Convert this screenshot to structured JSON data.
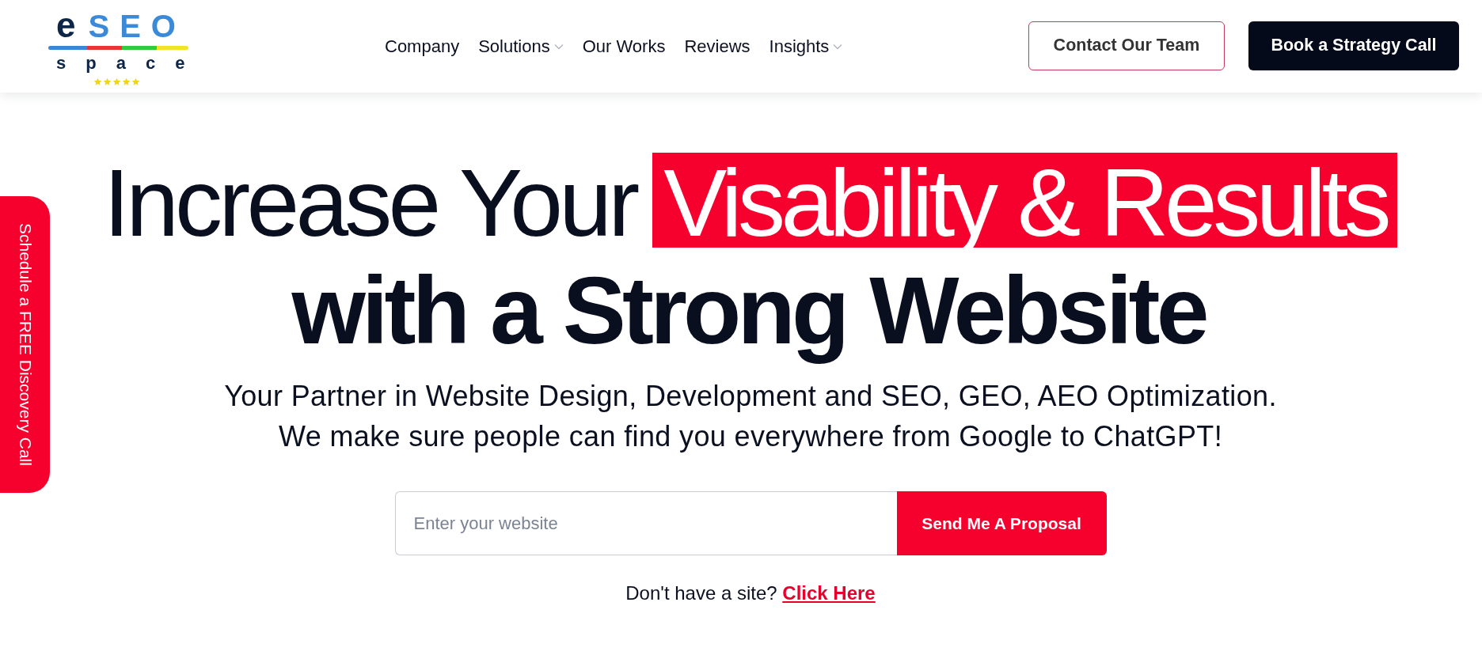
{
  "header": {
    "logo": {
      "wordmark": [
        {
          "text": "e",
          "color": "#0d2547"
        },
        {
          "text": "SEO",
          "color": "#3b8ad9"
        }
      ],
      "tagline": "space",
      "stars": 5
    },
    "nav": [
      {
        "label": "Company",
        "has_menu": false
      },
      {
        "label": "Solutions",
        "has_menu": true
      },
      {
        "label": "Our Works",
        "has_menu": false
      },
      {
        "label": "Reviews",
        "has_menu": false
      },
      {
        "label": "Insights",
        "has_menu": true
      }
    ],
    "actions": [
      {
        "label": "Contact Our Team",
        "kind": "outline"
      },
      {
        "label": "Book a Strategy Call",
        "kind": "solid"
      }
    ]
  },
  "side_tab": {
    "label": "Schedule a FREE Discovery Call"
  },
  "hero": {
    "headline": {
      "lead": "Increase Your",
      "highlight": "Visability & Results",
      "emphasis": "with a Strong Website"
    },
    "subtitle": [
      "Your Partner in Website Design, Development and SEO, GEO, AEO Optimization.",
      "We make sure people can find you everywhere from Google to ChatGPT!"
    ],
    "form": {
      "placeholder": "Enter your website",
      "button": "Send Me A Proposal"
    },
    "prompt": {
      "text": "Don't have a site?",
      "link": "Click Here"
    }
  }
}
